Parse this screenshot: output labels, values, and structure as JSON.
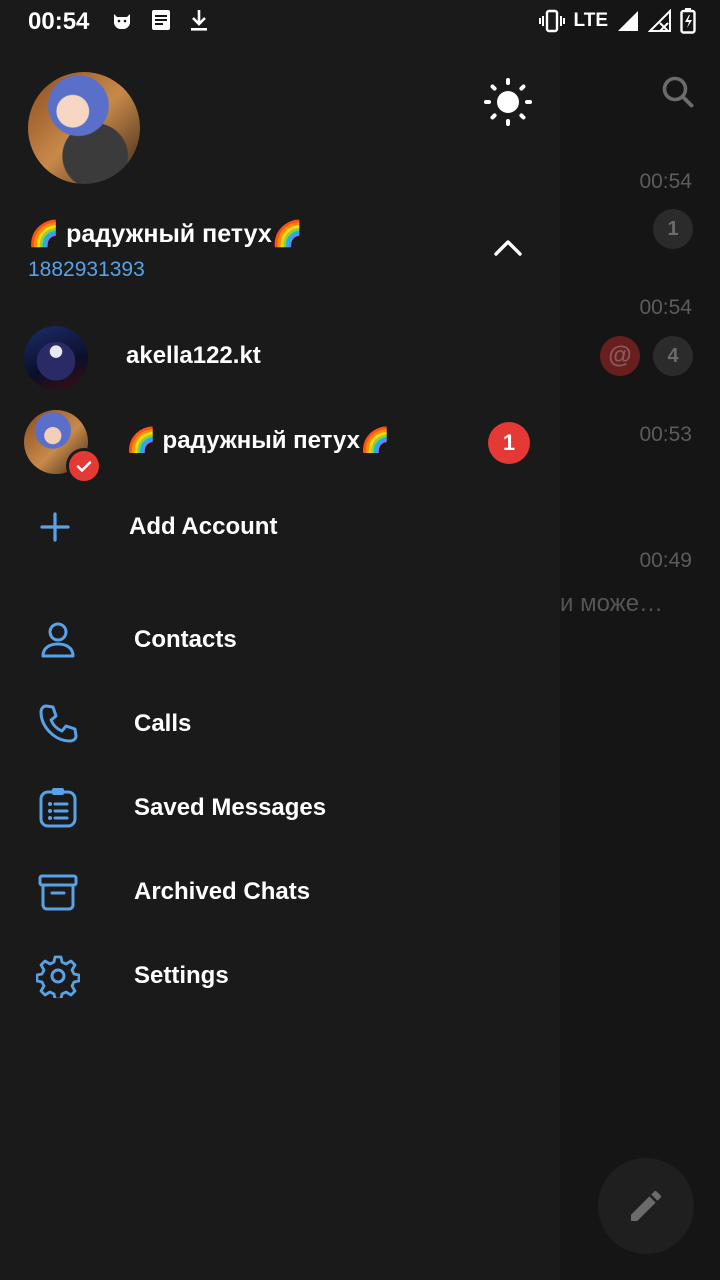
{
  "status_bar": {
    "time": "00:54",
    "network": "LTE"
  },
  "background_chats": {
    "times": [
      "00:54",
      "00:54",
      "00:53",
      "00:49"
    ],
    "badges": [
      "1",
      "4"
    ],
    "mention_symbol": "@",
    "preview_text": "и може…"
  },
  "drawer": {
    "user_name": "🌈 радужный петух🌈",
    "phone": "1882931393",
    "accounts": [
      {
        "name": "akella122.kt"
      },
      {
        "name": "🌈 радужный петух🌈",
        "unread": "1"
      }
    ],
    "add_account": "Add Account",
    "menu": [
      {
        "label": "Contacts",
        "icon": "contacts-icon"
      },
      {
        "label": "Calls",
        "icon": "phone-icon"
      },
      {
        "label": "Saved Messages",
        "icon": "saved-messages-icon"
      },
      {
        "label": "Archived Chats",
        "icon": "archive-icon"
      },
      {
        "label": "Settings",
        "icon": "settings-icon"
      }
    ]
  },
  "colors": {
    "accent_blue": "#5aa2e8",
    "badge_red": "#e53935",
    "drawer_bg": "#1a1a1a"
  }
}
